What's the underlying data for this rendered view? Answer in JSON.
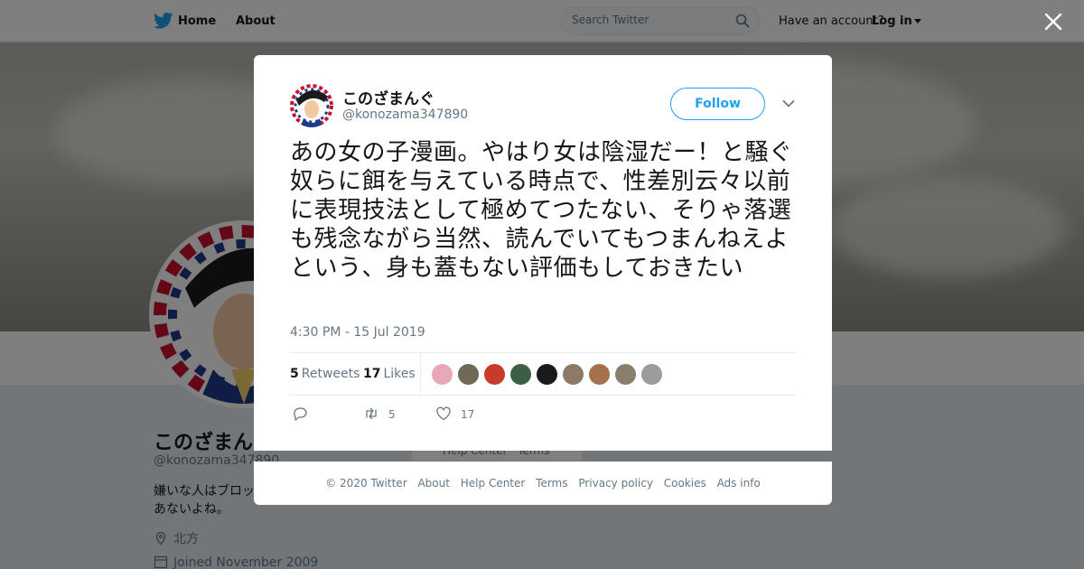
{
  "nav": {
    "home": "Home",
    "about": "About",
    "search_placeholder": "Search Twitter",
    "have_account": "Have an account?",
    "login": "Log in"
  },
  "profile": {
    "name": "このざまんぐ",
    "handle": "@konozama347890",
    "bio": "嫌いな人はブロッ…あないよね。",
    "bio_line1": "嫌いな人はブロッ",
    "bio_line2": "あないよね。",
    "location": "北方",
    "joined": "Joined November 2009",
    "bg_link_help": "Help Center",
    "bg_link_terms": "Terms"
  },
  "tweet": {
    "name": "このざまんぐ",
    "handle": "@konozama347890",
    "follow_label": "Follow",
    "text": "あの女の子漫画。やはり女は陰湿だー！と騒ぐ奴らに餌を与えている時点で、性差別云々以前に表現技法として極めてつたない、そりゃ落選も残念ながら当然、読んでいてもつまんねえよという、身も蓋もない評価もしておきたい",
    "timestamp": "4:30 PM - 15 Jul 2019",
    "retweets_count": "5",
    "retweets_label": "Retweets",
    "likes_count": "17",
    "likes_label": "Likes",
    "action_retweets": "5",
    "action_likes": "17",
    "liker_colors": [
      "#e6a9b8",
      "#6e6a55",
      "#c73b2b",
      "#3b5e45",
      "#1a1a1a",
      "#8d7a66",
      "#a3714c",
      "#8a7f6c",
      "#9c9c9c"
    ]
  },
  "footer": {
    "copyright": "© 2020 Twitter",
    "about": "About",
    "help": "Help Center",
    "terms": "Terms",
    "privacy": "Privacy policy",
    "cookies": "Cookies",
    "ads": "Ads info"
  },
  "colors": {
    "brand": "#1da1f2",
    "text_primary": "#14171a",
    "text_secondary": "#657786"
  }
}
